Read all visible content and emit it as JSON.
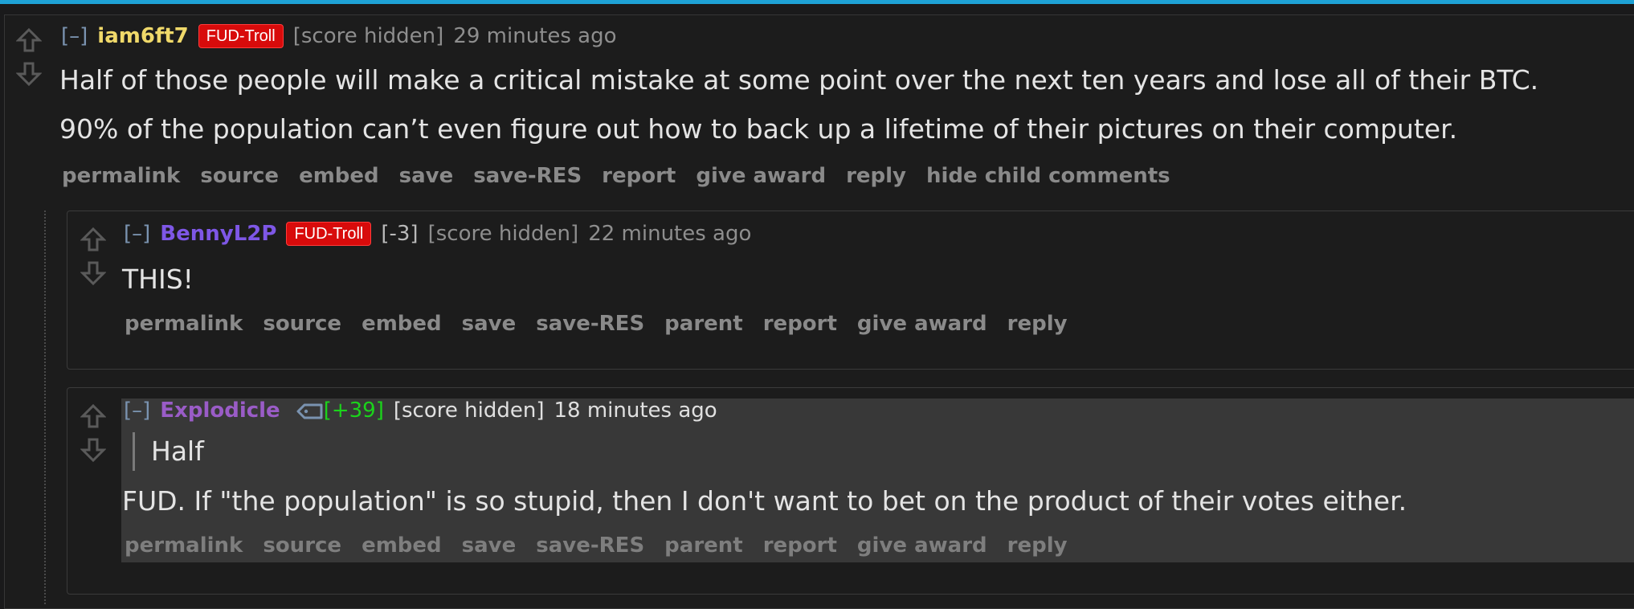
{
  "comments": [
    {
      "expand": "[–]",
      "author": "iam6ft7",
      "author_color": "#f0d96a",
      "flair": "FUD-Troll",
      "score": "[score hidden]",
      "time": "29 minutes ago",
      "body": [
        "Half of those people will make a critical mistake at some point over the next ten years and lose all of their BTC.",
        "90% of the population can’t even figure out how to back up a lifetime of their pictures on their computer."
      ],
      "buttons": [
        "permalink",
        "source",
        "embed",
        "save",
        "save-RES",
        "report",
        "give award",
        "reply",
        "hide child comments"
      ]
    },
    {
      "expand": "[–]",
      "author": "BennyL2P",
      "author_color": "#7e57e6",
      "flair": "FUD-Troll",
      "user_score": "[-3]",
      "score": "[score hidden]",
      "time": "22 minutes ago",
      "body": [
        "THIS!"
      ],
      "buttons": [
        "permalink",
        "source",
        "embed",
        "save",
        "save-RES",
        "parent",
        "report",
        "give award",
        "reply"
      ]
    },
    {
      "expand": "[–]",
      "author": "Explodicle",
      "author_color": "#9a5cc7",
      "tag_icon": "tag-icon",
      "user_score": "[+39]",
      "score": "[score hidden]",
      "time": "18 minutes ago",
      "quote": "Half",
      "body": [
        "FUD. If \"the population\" is so stupid, then I don't want to bet on the product of their votes either."
      ],
      "buttons": [
        "permalink",
        "source",
        "embed",
        "save",
        "save-RES",
        "parent",
        "report",
        "give award",
        "reply"
      ]
    }
  ]
}
